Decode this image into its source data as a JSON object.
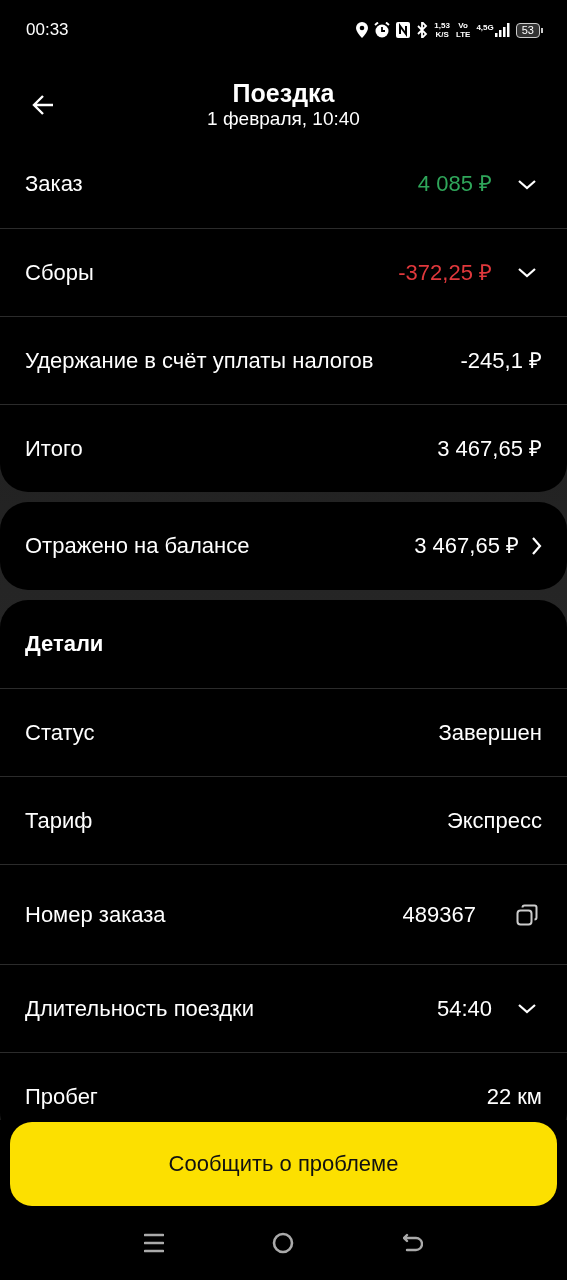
{
  "status_bar": {
    "time": "00:33",
    "net_speed": "1,53",
    "net_speed_unit": "K/S",
    "volte_top": "Vo",
    "volte_bottom": "LTE",
    "network": "4,5G",
    "battery": "53"
  },
  "header": {
    "title": "Поездка",
    "subtitle": "1 февраля, 10:40"
  },
  "summary": [
    {
      "kind": "expandable",
      "label": "Заказ",
      "value": "4 085 ₽",
      "color": "#2fa65a",
      "expanded": false
    },
    {
      "kind": "expandable",
      "label": "Сборы",
      "value": "-372,25 ₽",
      "color": "#e0383c",
      "expanded": false
    },
    {
      "kind": "plain",
      "label": "Удержание в счёт уплаты налогов",
      "value": "-245,1 ₽"
    },
    {
      "kind": "plain",
      "label": "Итого",
      "value": "3 467,65 ₽"
    }
  ],
  "balance": {
    "kind": "link",
    "label": "Отражено на балансе",
    "value": "3 467,65 ₽"
  },
  "details": {
    "title": "Детали",
    "rows": [
      {
        "kind": "plain",
        "label": "Статус",
        "value": "Завершен"
      },
      {
        "kind": "plain",
        "label": "Тариф",
        "value": "Экспресс"
      },
      {
        "kind": "copy",
        "label": "Номер заказа",
        "value": "489367"
      },
      {
        "kind": "expandable",
        "label": "Длительность поездки",
        "value": "54:40",
        "expanded": false
      },
      {
        "kind": "plain",
        "label": "Пробег",
        "value": "22 км"
      }
    ]
  },
  "report_button": "Сообщить о проблеме"
}
